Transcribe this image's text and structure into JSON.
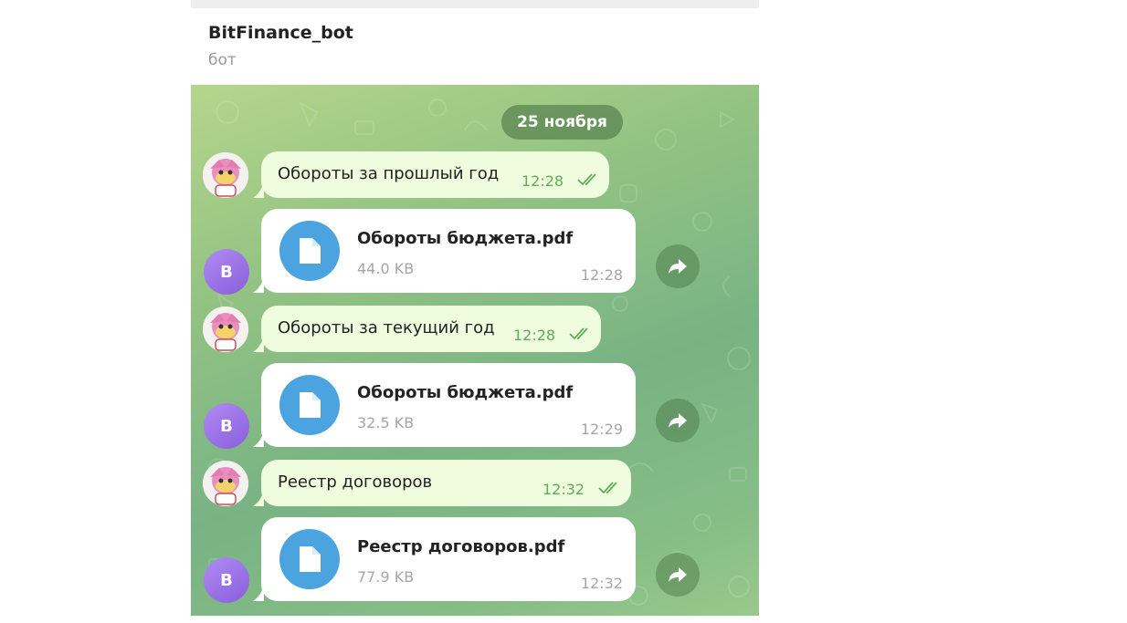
{
  "header": {
    "title": "BitFinance_bot",
    "subtitle": "бот"
  },
  "chat": {
    "date_separator": "25 ноября",
    "messages": [
      {
        "type": "outgoing",
        "text": "Обороты за прошлый год",
        "time": "12:28"
      },
      {
        "type": "file",
        "avatar_letter": "B",
        "file_name": "Обороты бюджета.pdf",
        "file_size": "44.0 KB",
        "time": "12:28"
      },
      {
        "type": "outgoing",
        "text": "Обороты за текущий год",
        "time": "12:28"
      },
      {
        "type": "file",
        "avatar_letter": "B",
        "file_name": "Обороты бюджета.pdf",
        "file_size": "32.5 KB",
        "time": "12:29"
      },
      {
        "type": "outgoing",
        "text": "Реестр договоров",
        "time": "12:32"
      },
      {
        "type": "file",
        "avatar_letter": "B",
        "file_name": "Реестр договоров.pdf",
        "file_size": "77.9 KB",
        "time": "12:32"
      }
    ]
  },
  "colors": {
    "outgoing_bubble": "#effdde",
    "incoming_bubble": "#ffffff",
    "file_icon": "#4ba4e0",
    "read_check": "#5fac57",
    "avatar_b": "#8a5ddc"
  }
}
